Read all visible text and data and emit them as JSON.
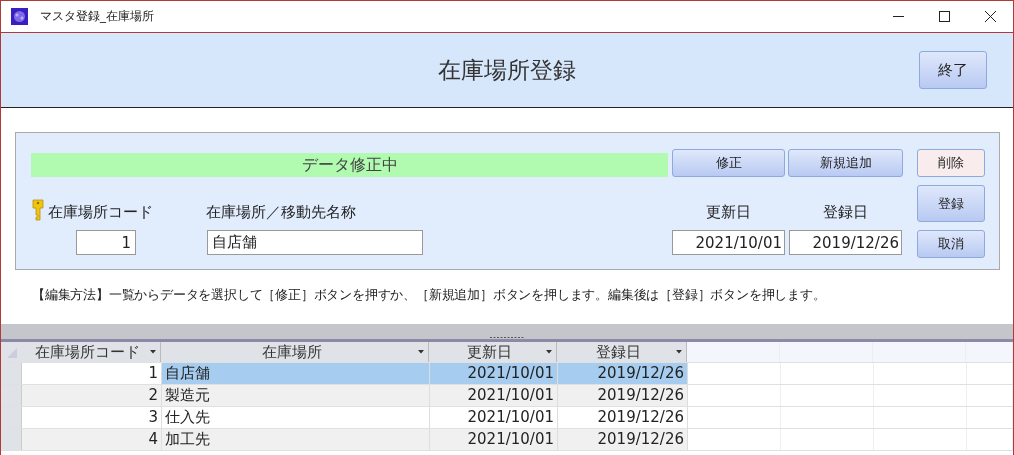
{
  "window": {
    "title": "マスタ登録_在庫場所"
  },
  "header": {
    "title": "在庫場所登録",
    "close_button": "終了"
  },
  "form": {
    "status": "データ修正中",
    "fields": [
      {
        "label": "在庫場所コード",
        "value": "1",
        "kind": "key"
      },
      {
        "label": "在庫場所／移動先名称",
        "value": "自店舗",
        "kind": "text"
      },
      {
        "label": "更新日",
        "value": "2021/10/01",
        "kind": "date"
      },
      {
        "label": "登録日",
        "value": "2019/12/26",
        "kind": "date"
      }
    ],
    "buttons": [
      {
        "label": "修正",
        "kind": "normal"
      },
      {
        "label": "新規追加",
        "kind": "normal"
      },
      {
        "label": "削除",
        "kind": "danger"
      },
      {
        "label": "登録",
        "kind": "normal"
      },
      {
        "label": "取消",
        "kind": "normal"
      }
    ]
  },
  "instructions": "【編集方法】一覧からデータを選択して［修正］ボタンを押すか、［新規追加］ボタンを押します。編集後は［登録］ボタンを押します。",
  "table": {
    "columns": [
      "在庫場所コード",
      "在庫場所",
      "更新日",
      "登録日"
    ],
    "rows": [
      {
        "cells": [
          "1",
          "自店舗",
          "2021/10/01",
          "2019/12/26"
        ],
        "selected": true
      },
      {
        "cells": [
          "2",
          "製造元",
          "2021/10/01",
          "2019/12/26"
        ],
        "selected": false
      },
      {
        "cells": [
          "3",
          "仕入先",
          "2021/10/01",
          "2019/12/26"
        ],
        "selected": false
      },
      {
        "cells": [
          "4",
          "加工先",
          "2021/10/01",
          "2019/12/26"
        ],
        "selected": false
      }
    ]
  }
}
